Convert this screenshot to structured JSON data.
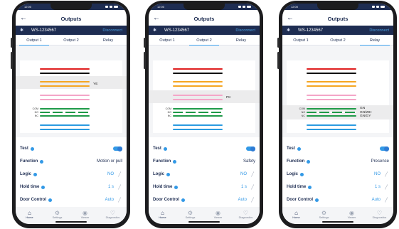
{
  "common": {
    "page_title": "Outputs",
    "device_name": "WS-1234567",
    "disconnect_label": "Disconnect",
    "tabs": [
      "Output 1",
      "Output 2",
      "Relay"
    ],
    "rows": {
      "test": "Test",
      "function": "Function",
      "logic": "Logic",
      "hold_time": "Hold time",
      "door_control": "Door Control"
    },
    "nav": [
      "Home",
      "Settings",
      "Viewer",
      "Diagnostics"
    ],
    "terminal_labels": [
      "COM",
      "NO",
      "NC"
    ],
    "colors": {
      "navy": "#1e2d52",
      "accent": "#3399e6",
      "red": "#e02020",
      "black": "#111111",
      "orange": "#f5a623",
      "pink": "#f4a6c8",
      "green": "#1f9a48",
      "blue": "#2b9be0"
    }
  },
  "phones": [
    {
      "status_time": "12:00",
      "active_tab": 0,
      "highlight_label": "YE",
      "function_value": "Motion or pull",
      "logic_value": "NO",
      "hold_time_value": "1 s",
      "door_control_value": "Auto",
      "test_on": true
    },
    {
      "status_time": "12:00",
      "active_tab": 1,
      "highlight_label": "PK",
      "function_value": "Safety",
      "logic_value": "NO",
      "hold_time_value": "1 s",
      "door_control_value": "Auto",
      "test_on": true
    },
    {
      "status_time": "12:00",
      "active_tab": 2,
      "highlight_labels": [
        "GN",
        "GN/WH",
        "GN/GY"
      ],
      "function_value": "Presence",
      "logic_value": "NO",
      "hold_time_value": "1 s",
      "door_control_value": "Auto",
      "test_on": true
    }
  ]
}
